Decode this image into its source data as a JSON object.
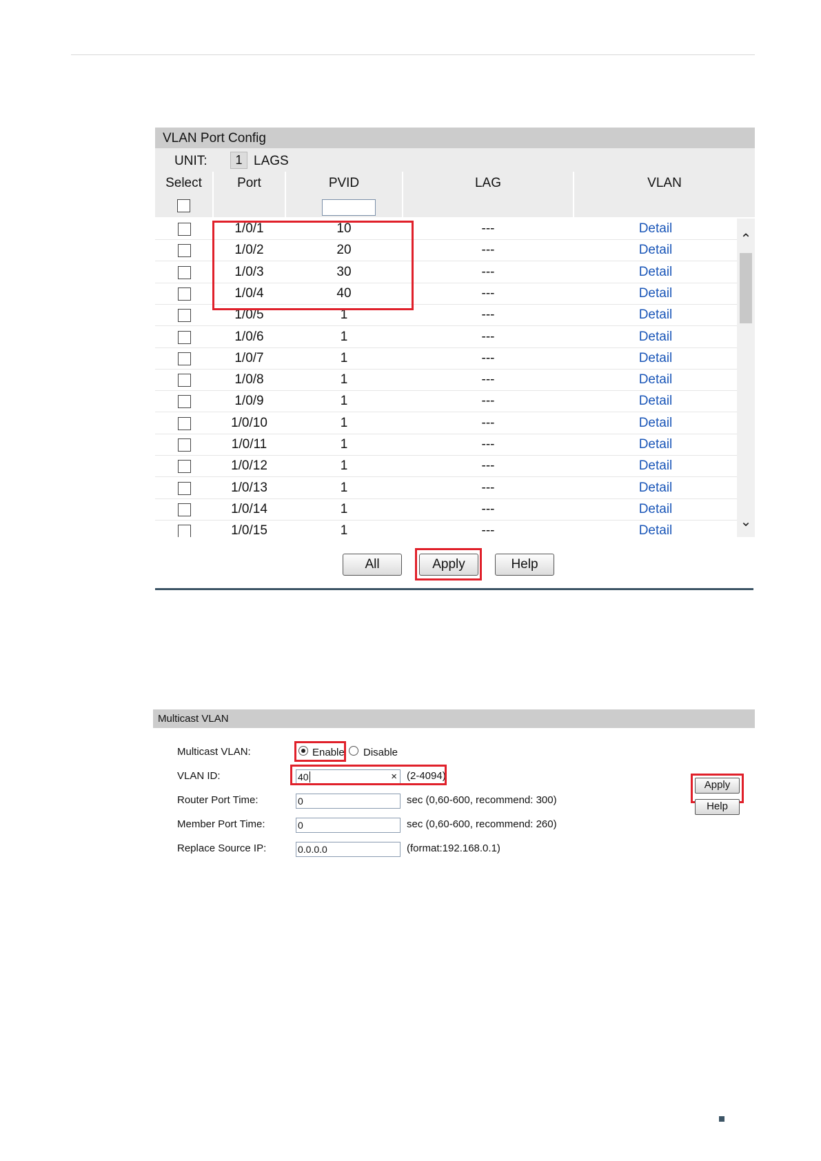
{
  "vlan_port_config": {
    "title": "VLAN Port Config",
    "unit_label": "UNIT:",
    "unit_value": "1",
    "lags_label": "LAGS",
    "columns": [
      "Select",
      "Port",
      "PVID",
      "LAG",
      "VLAN"
    ],
    "pvid_filter_value": "",
    "rows": [
      {
        "port": "1/0/1",
        "pvid": "10",
        "lag": "---",
        "vlan": "Detail"
      },
      {
        "port": "1/0/2",
        "pvid": "20",
        "lag": "---",
        "vlan": "Detail"
      },
      {
        "port": "1/0/3",
        "pvid": "30",
        "lag": "---",
        "vlan": "Detail"
      },
      {
        "port": "1/0/4",
        "pvid": "40",
        "lag": "---",
        "vlan": "Detail"
      },
      {
        "port": "1/0/5",
        "pvid": "1",
        "lag": "---",
        "vlan": "Detail"
      },
      {
        "port": "1/0/6",
        "pvid": "1",
        "lag": "---",
        "vlan": "Detail"
      },
      {
        "port": "1/0/7",
        "pvid": "1",
        "lag": "---",
        "vlan": "Detail"
      },
      {
        "port": "1/0/8",
        "pvid": "1",
        "lag": "---",
        "vlan": "Detail"
      },
      {
        "port": "1/0/9",
        "pvid": "1",
        "lag": "---",
        "vlan": "Detail"
      },
      {
        "port": "1/0/10",
        "pvid": "1",
        "lag": "---",
        "vlan": "Detail"
      },
      {
        "port": "1/0/11",
        "pvid": "1",
        "lag": "---",
        "vlan": "Detail"
      },
      {
        "port": "1/0/12",
        "pvid": "1",
        "lag": "---",
        "vlan": "Detail"
      },
      {
        "port": "1/0/13",
        "pvid": "1",
        "lag": "---",
        "vlan": "Detail"
      },
      {
        "port": "1/0/14",
        "pvid": "1",
        "lag": "---",
        "vlan": "Detail"
      },
      {
        "port": "1/0/15",
        "pvid": "1",
        "lag": "---",
        "vlan": "Detail"
      }
    ],
    "buttons": {
      "all": "All",
      "apply": "Apply",
      "help": "Help"
    },
    "icons": {
      "scroll_up": "chevron-up-icon",
      "scroll_down": "chevron-down-icon"
    }
  },
  "multicast_vlan": {
    "title": "Multicast VLAN",
    "status_label": "Multicast VLAN:",
    "enable_label": "Enable",
    "disable_label": "Disable",
    "selected": "Enable",
    "vlan_id_label": "VLAN ID:",
    "vlan_id_value": "40",
    "vlan_id_hint": "(2-4094)",
    "clear_glyph": "×",
    "router_port_time_label": "Router Port Time:",
    "router_port_time_value": "0",
    "router_port_time_hint": "sec (0,60-600, recommend: 300)",
    "member_port_time_label": "Member Port Time:",
    "member_port_time_value": "0",
    "member_port_time_hint": "sec (0,60-600, recommend: 260)",
    "replace_source_ip_label": "Replace Source IP:",
    "replace_source_ip_value": "0.0.0.0",
    "replace_source_ip_hint": "(format:192.168.0.1)",
    "buttons": {
      "apply": "Apply",
      "help": "Help"
    }
  },
  "colors": {
    "highlight": "#e0202a",
    "link": "#1a56b8",
    "panel_header": "#cccccc",
    "rule": "#3d5566"
  }
}
